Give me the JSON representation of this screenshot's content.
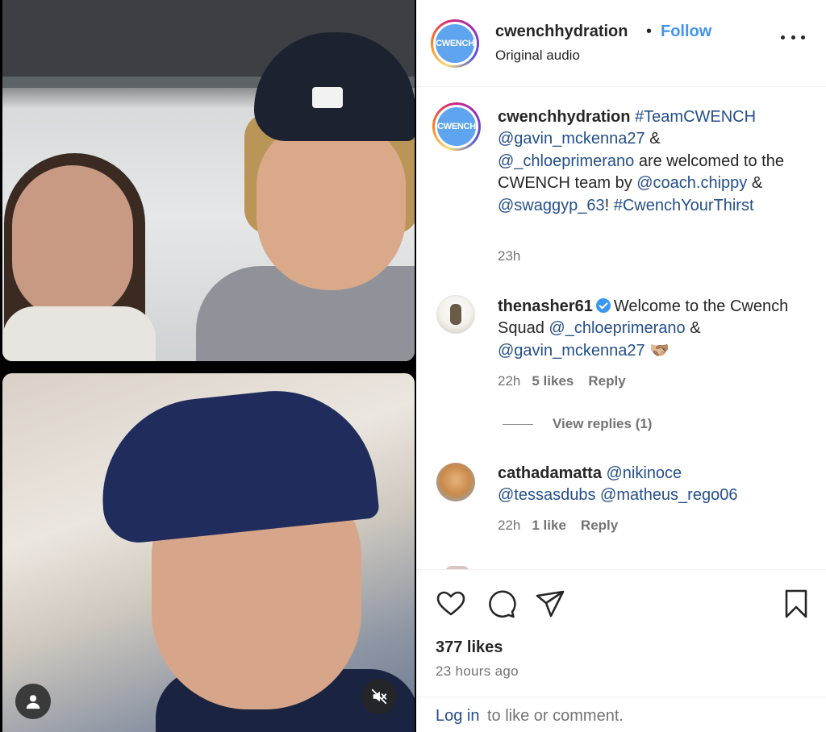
{
  "post": {
    "username": "cwenchhydration",
    "avatar_text": "CWENCH",
    "follow_label": "Follow",
    "separator": "•",
    "audio": "Original audio"
  },
  "caption": {
    "username": "cwenchhydration",
    "parts": {
      "tag1": "#TeamCWENCH",
      "mention1": "@gavin_mckenna27",
      "amp1": " & ",
      "mention2": "@_chloeprimerano",
      "text1": " are welcomed to the CWENCH team by ",
      "mention3": "@coach.chippy",
      "amp2": " & ",
      "mention4": "@swaggyp_63",
      "text2": "! ",
      "tag2": "#CwenchYourThirst"
    },
    "time": "23h"
  },
  "comments": [
    {
      "username": "thenasher61",
      "verified": true,
      "text1": "Welcome to the Cwench Squad ",
      "mention1": "@_chloeprimerano",
      "amp": " & ",
      "mention2": "@gavin_mckenna27",
      "emoji": " 🫱🏼‍🫲🏽",
      "time": "22h",
      "likes": "5 likes",
      "reply_label": "Reply",
      "view_replies": "View replies (1)"
    },
    {
      "username": "cathadamatta",
      "mention1": "@nikinoce",
      "mention2": "@tessasdubs",
      "mention3": "@matheus_rego06",
      "time": "22h",
      "likes": "1 like",
      "reply_label": "Reply"
    }
  ],
  "footer": {
    "likes": "377 likes",
    "time_ago": "23 hours ago",
    "login_link": "Log in",
    "login_rest": " to like or comment."
  },
  "icons": {
    "heart": "heart-icon",
    "comment": "comment-icon",
    "share": "share-icon",
    "bookmark": "bookmark-icon",
    "more": "more-options-icon",
    "user_tag": "user-tag-icon",
    "mute": "mute-icon"
  },
  "colors": {
    "accent_blue": "#4293f0",
    "mention_blue": "#244f8a",
    "secondary_text": "#737373",
    "avatar_bg": "#5fa4ef"
  }
}
